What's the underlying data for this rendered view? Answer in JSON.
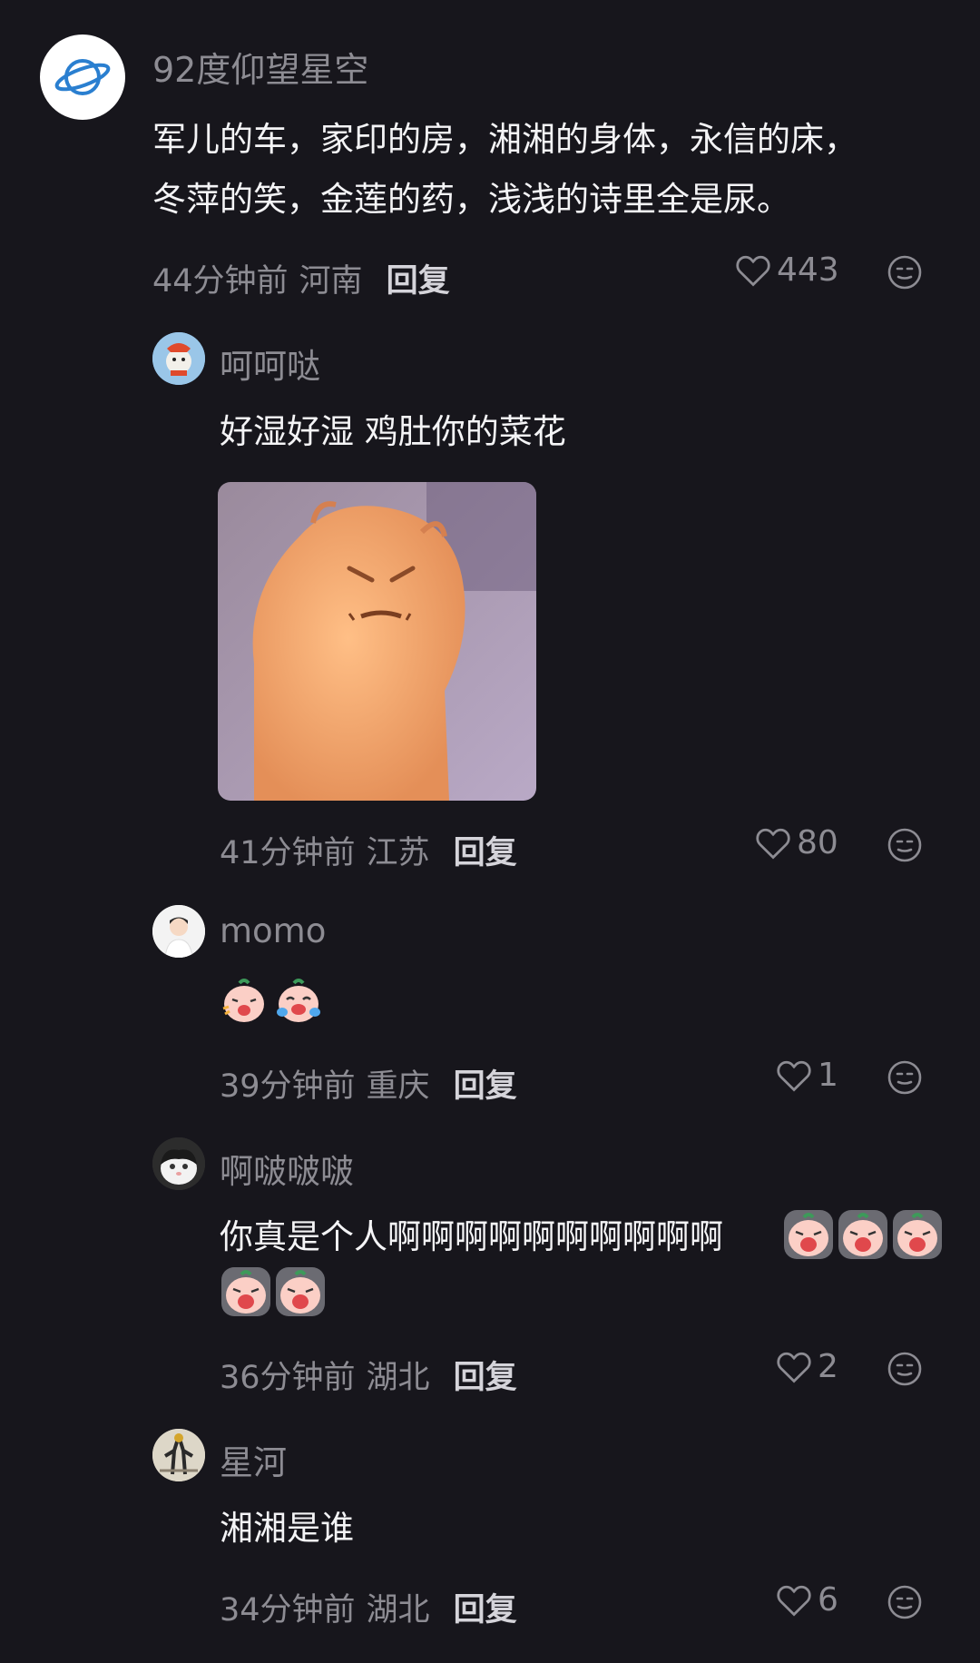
{
  "comments": [
    {
      "username": "92度仰望星空",
      "text_lines": [
        "军儿的车，家印的房，湘湘的身体，永信的床，",
        "冬萍的笑，金莲的药，浅浅的诗里全是尿。"
      ],
      "time": "44分钟前",
      "location": "河南",
      "reply_label": "回复",
      "likes": "443",
      "avatar_icon": "planet-icon"
    }
  ],
  "replies": [
    {
      "username": "呵呵哒",
      "text": "好湿好湿 鸡肚你的菜花",
      "time": "41分钟前",
      "location": "江苏",
      "reply_label": "回复",
      "likes": "80",
      "image": "angry-cat-meme"
    },
    {
      "username": "momo",
      "text": "",
      "emojis": [
        "laughing-emoji",
        "crying-laughing-emoji"
      ],
      "time": "39分钟前",
      "location": "重庆",
      "reply_label": "回复",
      "likes": "1"
    },
    {
      "username": "啊啵啵啵",
      "text_line1": "你真是个人啊啊啊啊啊啊啊啊啊啊",
      "emojis_count": 5,
      "time": "36分钟前",
      "location": "湖北",
      "reply_label": "回复",
      "likes": "2"
    },
    {
      "username": "星河",
      "text": "湘湘是谁",
      "time": "34分钟前",
      "location": "湖北",
      "reply_label": "回复",
      "likes": "6"
    }
  ],
  "colors": {
    "background": "#17161c",
    "muted_text": "#8d8c93",
    "body_text": "#f4f4f6"
  }
}
